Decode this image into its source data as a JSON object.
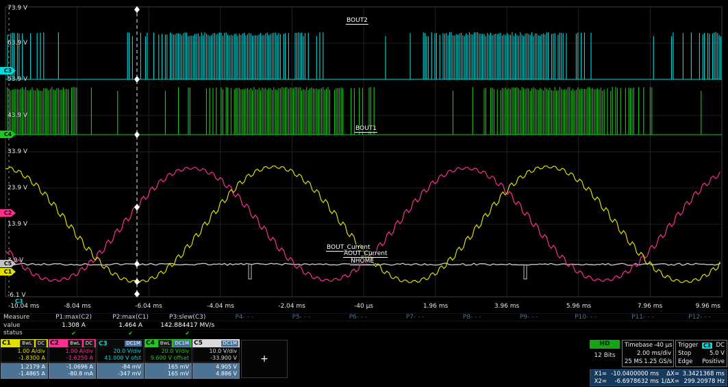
{
  "colors": {
    "c1_yellow": "#e0e000",
    "c2_magenta": "#ff2f92",
    "c3_cyan": "#00dcdc",
    "c4_green": "#1ec91e",
    "c5_gray": "#c4c4c4",
    "grid": "#212121",
    "cursor_value_box": "#4c7294",
    "hd_green": "#17a317",
    "status_check_green": "#2ad42a",
    "readout_box_blue": "#173a5c"
  },
  "plot": {
    "y_labels": [
      "73.9 V",
      "63.9 V",
      "53.9 V",
      "43.9 V",
      "33.9 V",
      "23.9 V",
      "13.9 V",
      "3.9 V",
      "-6.1 V"
    ],
    "x_labels": [
      "-10.04 ms",
      "-8.04 ms",
      "-6.04 ms",
      "-4.04 ms",
      "-2.04 ms",
      "-40 µs",
      "1.96 ms",
      "3.96 ms",
      "5.96 ms",
      "7.96 ms",
      "9.96 ms"
    ],
    "trace_labels": [
      "BOUT2",
      "BOUT1",
      "BOUT_Current",
      "AOUT_Current",
      "NHOME"
    ],
    "channel_markers": [
      {
        "id": "C3"
      },
      {
        "id": "C4"
      },
      {
        "id": "C2"
      },
      {
        "id": "C5"
      },
      {
        "id": "C1"
      }
    ],
    "trigger_marker": "C3"
  },
  "measure": {
    "row_labels": [
      "Measure",
      "value",
      "status"
    ],
    "params": [
      {
        "label": "P1:max(C2)",
        "value": "1.308 A",
        "status": "✔"
      },
      {
        "label": "P2:max(C1)",
        "value": "1.464 A",
        "status": "✔"
      },
      {
        "label": "P3:slew(C3)",
        "value": "142.884417 MV/s",
        "status": "✔"
      },
      {
        "label": "P4- - -",
        "value": "",
        "status": ""
      },
      {
        "label": "P5- - -",
        "value": "",
        "status": ""
      },
      {
        "label": "P6- - -",
        "value": "",
        "status": ""
      },
      {
        "label": "P7- - -",
        "value": "",
        "status": ""
      },
      {
        "label": "P8- - -",
        "value": "",
        "status": ""
      },
      {
        "label": "P9- - -",
        "value": "",
        "status": ""
      },
      {
        "label": "P10- - -",
        "value": "",
        "status": ""
      },
      {
        "label": "P11- - -",
        "value": "",
        "status": ""
      },
      {
        "label": "P12- - -",
        "value": "",
        "status": ""
      }
    ]
  },
  "channels": [
    {
      "id": "C1",
      "tags": [
        "BwL",
        "DC"
      ],
      "line1": "1.00 A/div",
      "line2": "-1.8300 A",
      "v1": "1.2179 A",
      "v2": "-1.4865 A"
    },
    {
      "id": "C2",
      "tags": [
        "BwL",
        "DC"
      ],
      "line1": "1.00 A/div",
      "line2": "-1.6250 A",
      "v1": "-1.0696 A",
      "v2": "-80.8 mA"
    },
    {
      "id": "C3",
      "tags": [
        "DC1M"
      ],
      "line1": "20.0 V/div",
      "line2": "41.000 V ofst",
      "v1": "-84 mV",
      "v2": "-347 mV"
    },
    {
      "id": "C4",
      "tags": [
        "BwL",
        "DC1M"
      ],
      "line1": "20.0 V/div",
      "line2": "9.600 V offset",
      "v1": "165 mV",
      "v2": "165 mV"
    },
    {
      "id": "C5",
      "tags": [
        "DC1M"
      ],
      "line1": "10.0 V/div",
      "line2": "-33.900 V",
      "v1": "4.905 V",
      "v2": "4.886 V"
    }
  ],
  "panels": {
    "hd": {
      "label": "HD",
      "bits": "12 Bits"
    },
    "timebase": {
      "title": "Timebase",
      "delay": "-40 µs",
      "scale": "2.00 ms/div",
      "samples": "25 MS",
      "rate": "1.25 GS/s"
    },
    "trigger": {
      "title": "Trigger",
      "source": "C3",
      "coupling": "DC",
      "mode": "Stop",
      "level": "5.0 V",
      "type": "Edge",
      "slope": "Positive"
    },
    "cursor_readout": {
      "x1_label": "X1=",
      "x1_value": "-10.0400000 ms",
      "x2_label": "X2=",
      "x2_value": "-6.6978632 ms",
      "dx_label": "ΔX=",
      "dx_value": "3.3421368 ms",
      "invdx_label": "1/ΔX=",
      "invdx_value": "299.20978 Hz"
    },
    "plus_marker": "+"
  }
}
